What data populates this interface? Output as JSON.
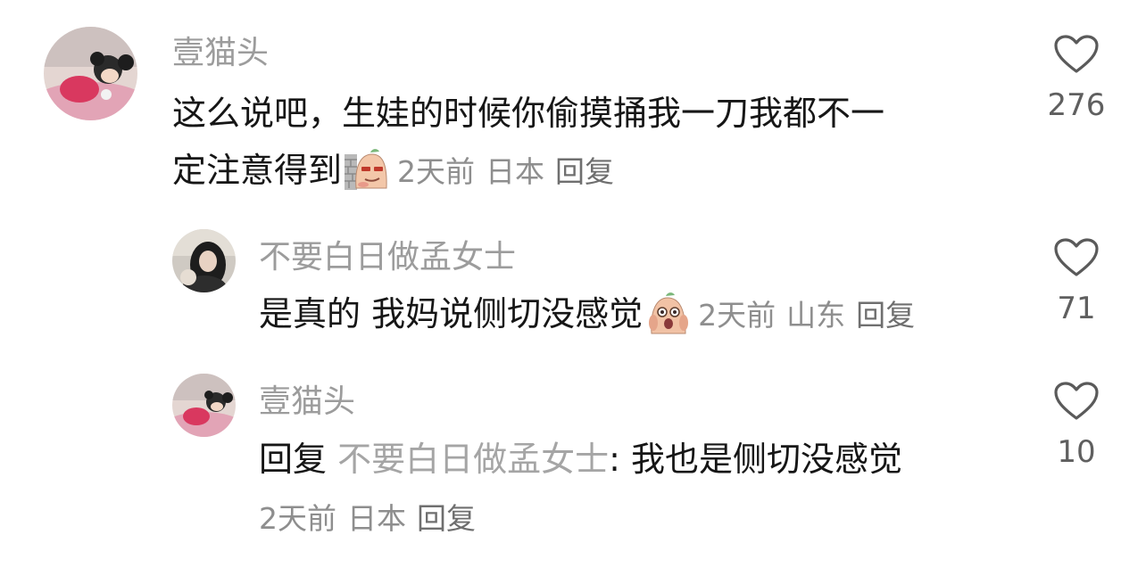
{
  "comments": [
    {
      "username": "壹猫头",
      "text_line1": "这么说吧，生娃的时候你偷摸捅我一刀我都不一",
      "text_line2": "定注意得到",
      "time": "2天前",
      "location": "日本",
      "reply_label": "回复",
      "likes": "276",
      "emoji_icon": "smug-potato-emoji"
    },
    {
      "username": "不要白日做孟女士",
      "text": "是真的 我妈说侧切没感觉",
      "time": "2天前",
      "location": "山东",
      "reply_label": "回复",
      "likes": "71",
      "emoji_icon": "surprised-potato-emoji"
    },
    {
      "username": "壹猫头",
      "reply_prefix": "回复",
      "mention": "不要白日做孟女士",
      "text": ": 我也是侧切没感觉",
      "time": "2天前",
      "location": "日本",
      "reply_label": "回复",
      "likes": "10"
    }
  ],
  "icons": {
    "like": "heart-outline-icon"
  },
  "colors": {
    "username": "#9c9c9c",
    "text": "#161616",
    "meta": "#8e8e8e"
  }
}
